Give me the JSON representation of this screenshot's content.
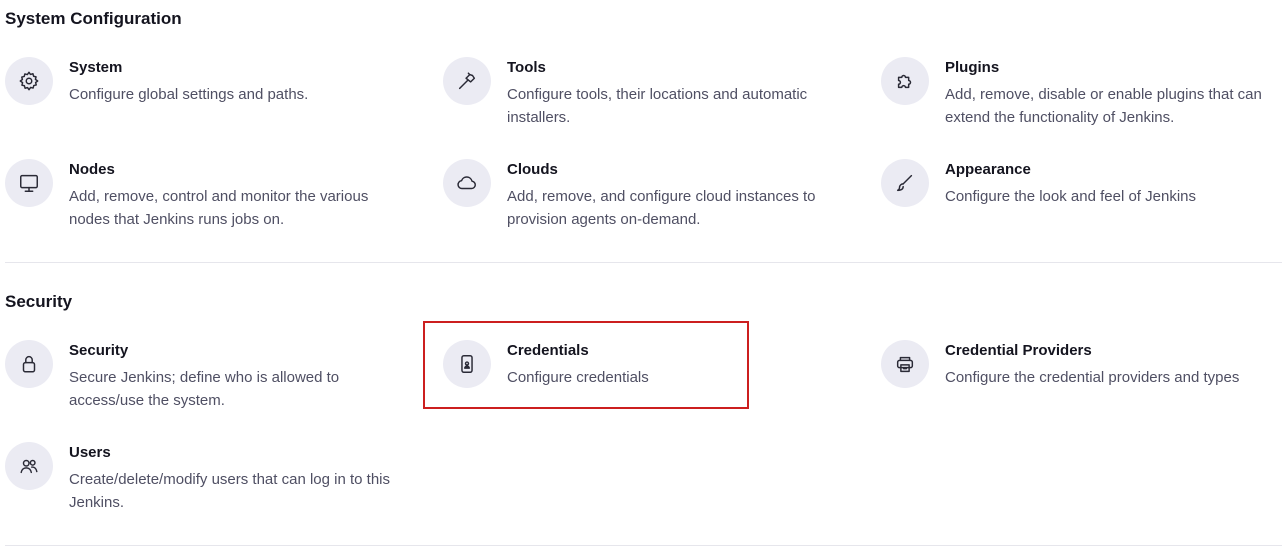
{
  "sections": {
    "system_configuration": {
      "title": "System Configuration",
      "items": [
        {
          "title": "System",
          "description": "Configure global settings and paths.",
          "icon": "gear-icon"
        },
        {
          "title": "Tools",
          "description": "Configure tools, their locations and automatic installers.",
          "icon": "hammer-icon"
        },
        {
          "title": "Plugins",
          "description": "Add, remove, disable or enable plugins that can extend the functionality of Jenkins.",
          "icon": "puzzle-icon"
        },
        {
          "title": "Nodes",
          "description": "Add, remove, control and monitor the various nodes that Jenkins runs jobs on.",
          "icon": "monitor-icon"
        },
        {
          "title": "Clouds",
          "description": "Add, remove, and configure cloud instances to provision agents on-demand.",
          "icon": "cloud-icon"
        },
        {
          "title": "Appearance",
          "description": "Configure the look and feel of Jenkins",
          "icon": "brush-icon"
        }
      ]
    },
    "security": {
      "title": "Security",
      "items": [
        {
          "title": "Security",
          "description": "Secure Jenkins; define who is allowed to access/use the system.",
          "icon": "lock-icon"
        },
        {
          "title": "Credentials",
          "description": "Configure credentials",
          "icon": "id-card-icon"
        },
        {
          "title": "Credential Providers",
          "description": "Configure the credential providers and types",
          "icon": "credential-providers-icon"
        },
        {
          "title": "Users",
          "description": "Create/delete/modify users that can log in to this Jenkins.",
          "icon": "users-icon"
        }
      ]
    }
  },
  "colors": {
    "highlight": "#cc1f1f",
    "icon_bg": "#ebebf3",
    "title": "#14141f",
    "description": "#4f4f63",
    "divider": "#e6e6ec"
  }
}
